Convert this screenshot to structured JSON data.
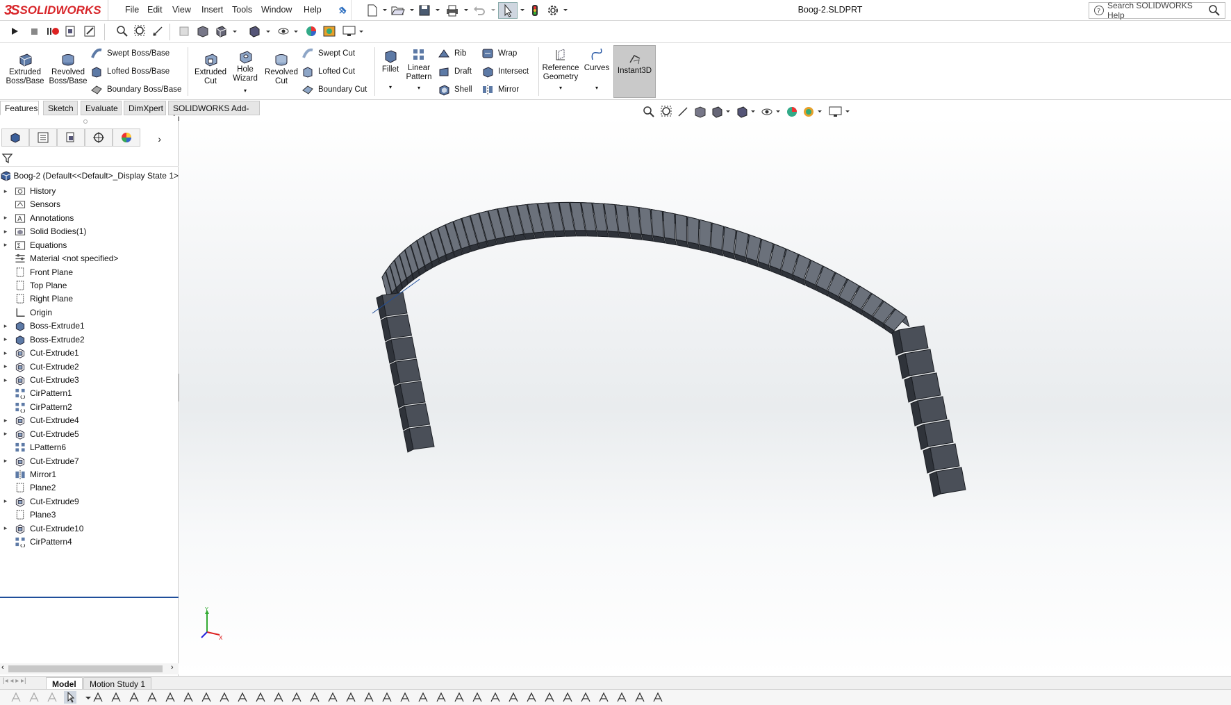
{
  "app": {
    "logo_ds": "3S",
    "logo_text": "SOLIDWORKS",
    "document_title": "Boog-2.SLDPRT"
  },
  "menu": [
    "File",
    "Edit",
    "View",
    "Insert",
    "Tools",
    "Window",
    "Help"
  ],
  "search": {
    "placeholder": "Search SOLIDWORKS Help"
  },
  "ribbon": {
    "extruded_boss": "Extruded Boss/Base",
    "revolved_boss": "Revolved Boss/Base",
    "swept_boss": "Swept Boss/Base",
    "lofted_boss": "Lofted Boss/Base",
    "boundary_boss": "Boundary Boss/Base",
    "extruded_cut": "Extruded Cut",
    "hole_wizard": "Hole Wizard",
    "revolved_cut": "Revolved Cut",
    "swept_cut": "Swept Cut",
    "lofted_cut": "Lofted Cut",
    "boundary_cut": "Boundary Cut",
    "fillet": "Fillet",
    "linear_pattern": "Linear Pattern",
    "rib": "Rib",
    "draft": "Draft",
    "shell": "Shell",
    "wrap": "Wrap",
    "intersect": "Intersect",
    "mirror": "Mirror",
    "reference_geometry": "Reference Geometry",
    "curves": "Curves",
    "instant3d": "Instant3D"
  },
  "tabs": [
    "Features",
    "Sketch",
    "Evaluate",
    "DimXpert",
    "SOLIDWORKS Add-Ins"
  ],
  "tree": {
    "root": "Boog-2  (Default<<Default>_Display State 1>",
    "items": [
      {
        "label": "History",
        "expandable": true,
        "icon": "history-folder-icon"
      },
      {
        "label": "Sensors",
        "expandable": false,
        "icon": "sensors-folder-icon"
      },
      {
        "label": "Annotations",
        "expandable": true,
        "icon": "annotations-icon"
      },
      {
        "label": "Solid Bodies(1)",
        "expandable": true,
        "icon": "solid-bodies-icon"
      },
      {
        "label": "Equations",
        "expandable": true,
        "icon": "equations-icon"
      },
      {
        "label": "Material <not specified>",
        "expandable": false,
        "icon": "material-icon"
      },
      {
        "label": "Front Plane",
        "expandable": false,
        "icon": "plane-icon"
      },
      {
        "label": "Top Plane",
        "expandable": false,
        "icon": "plane-icon"
      },
      {
        "label": "Right Plane",
        "expandable": false,
        "icon": "plane-icon"
      },
      {
        "label": "Origin",
        "expandable": false,
        "icon": "origin-icon"
      },
      {
        "label": "Boss-Extrude1",
        "expandable": true,
        "icon": "boss-extrude-icon"
      },
      {
        "label": "Boss-Extrude2",
        "expandable": true,
        "icon": "boss-extrude-icon"
      },
      {
        "label": "Cut-Extrude1",
        "expandable": true,
        "icon": "cut-extrude-icon"
      },
      {
        "label": "Cut-Extrude2",
        "expandable": true,
        "icon": "cut-extrude-icon"
      },
      {
        "label": "Cut-Extrude3",
        "expandable": true,
        "icon": "cut-extrude-icon"
      },
      {
        "label": "CirPattern1",
        "expandable": false,
        "icon": "circular-pattern-icon"
      },
      {
        "label": "CirPattern2",
        "expandable": false,
        "icon": "circular-pattern-icon"
      },
      {
        "label": "Cut-Extrude4",
        "expandable": true,
        "icon": "cut-extrude-icon"
      },
      {
        "label": "Cut-Extrude5",
        "expandable": true,
        "icon": "cut-extrude-icon"
      },
      {
        "label": "LPattern6",
        "expandable": false,
        "icon": "linear-pattern-icon"
      },
      {
        "label": "Cut-Extrude7",
        "expandable": true,
        "icon": "cut-extrude-icon"
      },
      {
        "label": "Mirror1",
        "expandable": false,
        "icon": "mirror-icon"
      },
      {
        "label": "Plane2",
        "expandable": false,
        "icon": "plane-icon"
      },
      {
        "label": "Cut-Extrude9",
        "expandable": true,
        "icon": "cut-extrude-icon"
      },
      {
        "label": "Plane3",
        "expandable": false,
        "icon": "plane-icon"
      },
      {
        "label": "Cut-Extrude10",
        "expandable": true,
        "icon": "cut-extrude-icon"
      },
      {
        "label": "CirPattern4",
        "expandable": false,
        "icon": "circular-pattern-icon"
      }
    ]
  },
  "bottom_tabs": [
    "Model",
    "Motion Study 1"
  ],
  "colors": {
    "brand_red": "#d8262a",
    "model_face": "#4a4f58",
    "model_edge": "#1c1f24",
    "selection_blue": "#1f4e9a"
  }
}
